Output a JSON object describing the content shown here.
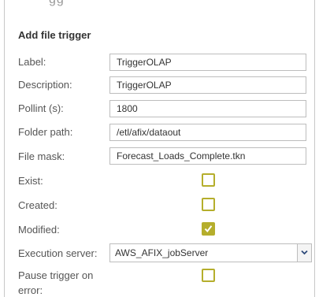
{
  "header": {
    "partial_title": "gg"
  },
  "form": {
    "title": "Add file trigger",
    "label": {
      "label": "Label:",
      "value": "TriggerOLAP"
    },
    "description": {
      "label": "Description:",
      "value": "TriggerOLAP"
    },
    "pollint": {
      "label": "Pollint (s):",
      "value": "1800"
    },
    "folder_path": {
      "label": "Folder path:",
      "value": "/etl/afix/dataout"
    },
    "file_mask": {
      "label": "File mask:",
      "value": "Forecast_Loads_Complete.tkn"
    },
    "exist": {
      "label": "Exist:",
      "checked": false
    },
    "created": {
      "label": "Created:",
      "checked": false
    },
    "modified": {
      "label": "Modified:",
      "checked": true
    },
    "execution_server": {
      "label": "Execution server:",
      "value": "AWS_AFIX_jobServer"
    },
    "pause_trigger": {
      "label_line1": "Pause trigger on",
      "label_line2": "error:",
      "checked": false
    }
  },
  "colors": {
    "accent": "#b5ae2c",
    "border": "#bdbdbd"
  },
  "icons": {
    "checkmark": "checkmark-icon",
    "dropdown": "chevron-down-icon"
  }
}
